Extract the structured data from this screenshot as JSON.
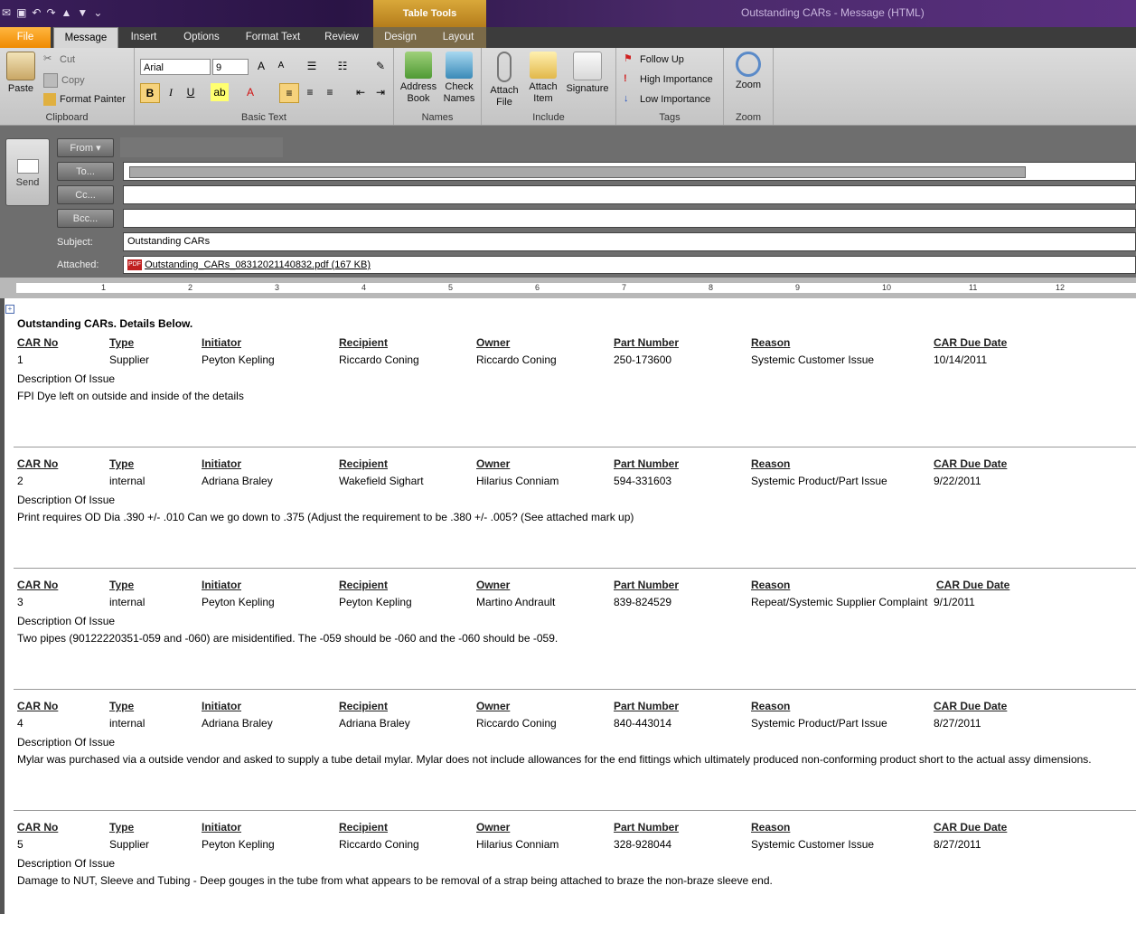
{
  "window": {
    "title": "Outstanding CARs - Message (HTML)",
    "context_tab_group": "Table Tools"
  },
  "tabs": [
    "File",
    "Message",
    "Insert",
    "Options",
    "Format Text",
    "Review",
    "Design",
    "Layout"
  ],
  "ribbon": {
    "clipboard": {
      "label": "Clipboard",
      "paste": "Paste",
      "cut": "Cut",
      "copy": "Copy",
      "format_painter": "Format Painter"
    },
    "basic_text": {
      "label": "Basic Text",
      "font": "Arial",
      "size": "9"
    },
    "names": {
      "label": "Names",
      "address_book": "Address Book",
      "check_names": "Check Names"
    },
    "include": {
      "label": "Include",
      "attach_file": "Attach File",
      "attach_item": "Attach Item",
      "signature": "Signature"
    },
    "tags": {
      "label": "Tags",
      "follow_up": "Follow Up",
      "high": "High Importance",
      "low": "Low Importance"
    },
    "zoom": {
      "label": "Zoom",
      "zoom": "Zoom"
    }
  },
  "compose": {
    "send": "Send",
    "from": "From",
    "to": "To...",
    "cc": "Cc...",
    "bcc": "Bcc...",
    "subject_label": "Subject:",
    "subject": "Outstanding CARs",
    "attached_label": "Attached:",
    "attachment": "Outstanding_CARs_08312021140832.pdf (167 KB)",
    "pdf_badge": "PDF"
  },
  "ruler_numbers": [
    "1",
    "2",
    "3",
    "4",
    "5",
    "6",
    "7",
    "8",
    "9",
    "10",
    "11",
    "12"
  ],
  "email": {
    "heading": "Outstanding CARs. Details Below.",
    "headers": {
      "car_no": "CAR No",
      "type": "Type",
      "initiator": "Initiator",
      "recipient": "Recipient",
      "owner": "Owner",
      "part_number": "Part Number",
      "reason": "Reason",
      "due": "CAR Due Date"
    },
    "desc_label": "Description Of Issue",
    "records": [
      {
        "car_no": "1",
        "type": "Supplier",
        "initiator": "Peyton Kepling",
        "recipient": "Riccardo Coning",
        "owner": "Riccardo Coning",
        "part_number": "250-173600",
        "reason": "Systemic Customer Issue",
        "due": "10/14/2011",
        "description": "FPI Dye left on outside and inside of the details"
      },
      {
        "car_no": "2",
        "type": "internal",
        "initiator": "Adriana Braley",
        "recipient": "Wakefield Sighart",
        "owner": "Hilarius Conniam",
        "part_number": "594-331603",
        "reason": "Systemic Product/Part Issue",
        "due": "9/22/2011",
        "description": "Print requires OD Dia .390 +/- .010 Can we go down to .375 (Adjust the requirement to be .380 +/- .005? (See attached mark up)"
      },
      {
        "car_no": "3",
        "type": "internal",
        "initiator": "Peyton Kepling",
        "recipient": "Peyton Kepling",
        "owner": "Martino Andrault",
        "part_number": "839-824529",
        "reason": "Repeat/Systemic Supplier Complaint",
        "due": "9/1/2011",
        "description": "Two pipes (90122220351-059 and -060) are misidentified. The -059 should be -060 and the -060 should be -059."
      },
      {
        "car_no": "4",
        "type": "internal",
        "initiator": "Adriana Braley",
        "recipient": "Adriana Braley",
        "owner": "Riccardo Coning",
        "part_number": "840-443014",
        "reason": "Systemic Product/Part Issue",
        "due": "8/27/2011",
        "description": "Mylar was purchased via a outside vendor and asked to supply a tube detail mylar. Mylar does not include allowances for the end fittings which ultimately produced non-conforming product short to the actual assy dimensions."
      },
      {
        "car_no": "5",
        "type": "Supplier",
        "initiator": "Peyton Kepling",
        "recipient": "Riccardo Coning",
        "owner": "Hilarius Conniam",
        "part_number": "328-928044",
        "reason": "Systemic Customer Issue",
        "due": "8/27/2011",
        "description": "Damage to NUT, Sleeve and Tubing - Deep gouges in the tube from what appears to be removal of a strap being attached to braze the non-braze sleeve end."
      }
    ]
  }
}
